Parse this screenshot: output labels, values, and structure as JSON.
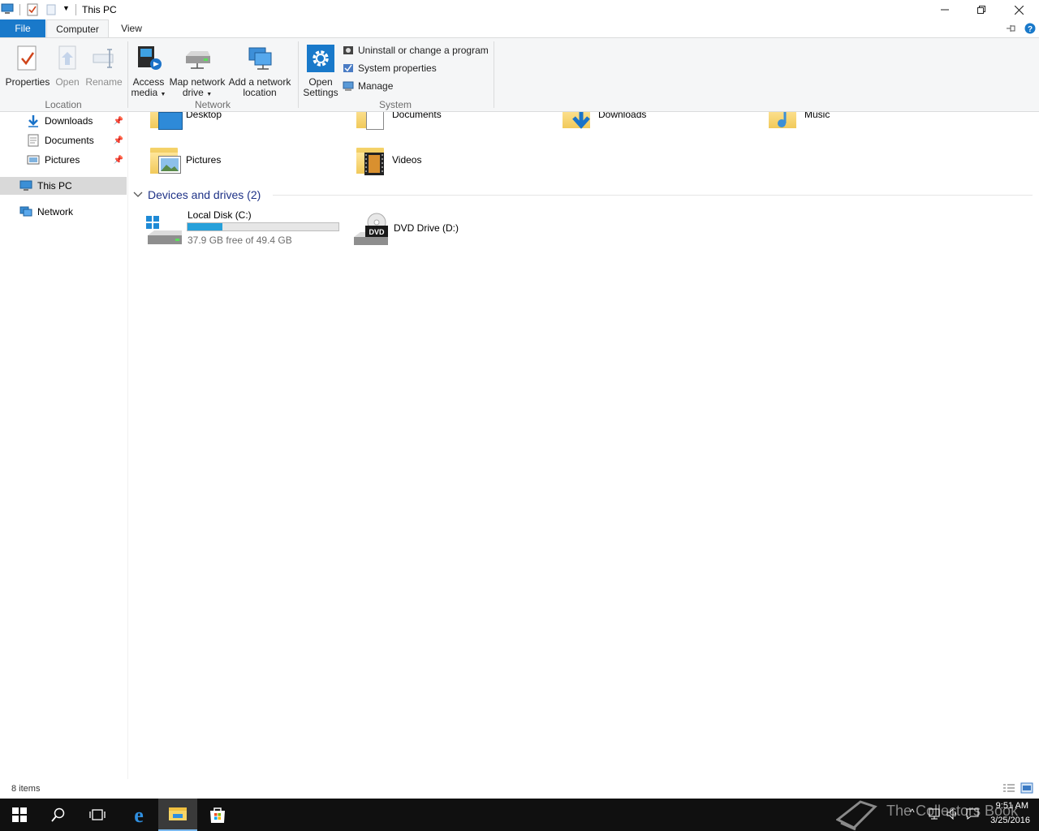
{
  "window": {
    "title": "This PC"
  },
  "tabs": {
    "file": "File",
    "computer": "Computer",
    "view": "View"
  },
  "ribbon": {
    "location": {
      "label": "Location",
      "properties": "Properties",
      "open": "Open",
      "rename": "Rename"
    },
    "network": {
      "label": "Network",
      "access_media_1": "Access",
      "access_media_2": "media",
      "map_drive_1": "Map network",
      "map_drive_2": "drive",
      "add_location_1": "Add a network",
      "add_location_2": "location"
    },
    "system": {
      "label": "System",
      "open_settings_1": "Open",
      "open_settings_2": "Settings",
      "uninstall": "Uninstall or change a program",
      "system_properties": "System properties",
      "manage": "Manage"
    }
  },
  "nav": {
    "items": [
      {
        "label": "Downloads",
        "icon": "download-icon",
        "pinned": true
      },
      {
        "label": "Documents",
        "icon": "document-icon",
        "pinned": true
      },
      {
        "label": "Pictures",
        "icon": "pictures-icon",
        "pinned": true
      },
      {
        "label": "This PC",
        "icon": "computer-icon",
        "selected": true
      },
      {
        "label": "Network",
        "icon": "network-icon"
      }
    ]
  },
  "folders": [
    {
      "label": "Desktop",
      "icon": "desktop-folder-icon"
    },
    {
      "label": "Documents",
      "icon": "documents-folder-icon"
    },
    {
      "label": "Downloads",
      "icon": "downloads-folder-icon"
    },
    {
      "label": "Music",
      "icon": "music-folder-icon"
    },
    {
      "label": "Pictures",
      "icon": "pictures-folder-icon"
    },
    {
      "label": "Videos",
      "icon": "videos-folder-icon"
    }
  ],
  "devices": {
    "header": "Devices and drives (2)",
    "items": [
      {
        "label": "Local Disk (C:)",
        "detail": "37.9 GB free of 49.4 GB",
        "used_fraction": 0.23,
        "icon": "local-disk-icon"
      },
      {
        "label": "DVD Drive (D:)",
        "icon": "dvd-drive-icon",
        "badge": "DVD"
      }
    ]
  },
  "status": {
    "items": "8 items"
  },
  "taskbar": {
    "time": "9:51 AM",
    "date": "3/25/2016",
    "watermark": "The Collectors Book"
  },
  "colors": {
    "accent": "#1979ca",
    "progress": "#26a0da",
    "section_header": "#1e3287",
    "selected_bg": "#d9d9d9"
  }
}
